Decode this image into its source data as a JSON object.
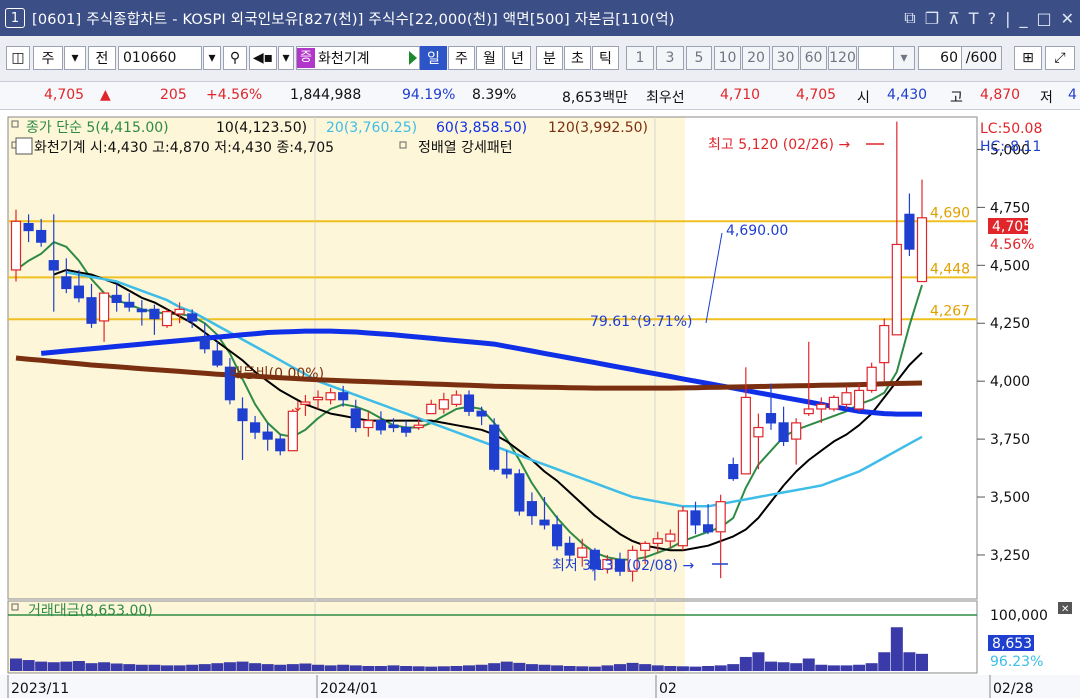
{
  "window": {
    "number": "1",
    "title": "[0601] 주식종합차트 - KOSPI 외국인보유[827(천)] 주식수[22,000(천)] 액면[500] 자본금[110(억)",
    "icons": [
      "restore-layout-icon",
      "duplicate-icon",
      "pin-icon",
      "font-icon",
      "help-icon",
      "minimize-icon",
      "maximize-icon",
      "close-icon"
    ]
  },
  "toolbar": {
    "market_label": "주",
    "prev_label": "전",
    "stock_code": "010660",
    "stock_tag": "증",
    "stock_name": "화천기계",
    "periods": [
      "일",
      "주",
      "월",
      "년",
      "분",
      "초",
      "틱"
    ],
    "selected_period": "일",
    "intervals": [
      "1",
      "3",
      "5",
      "10",
      "20",
      "30",
      "60",
      "120"
    ],
    "count_value": "60",
    "count_total": "/600"
  },
  "pricebar": {
    "price": "4,705",
    "change_arrow": "▲",
    "change": "205",
    "change_pct": "+4.56%",
    "volume": "1,844,988",
    "vol_ratio": "94.19%",
    "turnover": "8.39%",
    "amount": "8,653백만",
    "ask_label": "최우선",
    "ask1": "4,710",
    "ask2": "4,705",
    "open_label": "시",
    "open": "4,430",
    "high_label": "고",
    "high": "4,870",
    "low_label": "저",
    "low_trunc": "4"
  },
  "legend": {
    "close_ma_label": "종가 단순 5(4,415.00)",
    "ma10": "10(4,123.50)",
    "ma20": "20(3,760.25)",
    "ma60": "60(3,858.50)",
    "ma120": "120(3,992.50)",
    "ohlc": "화천기계 시:4,430 고:4,870 저:4,430 종:4,705",
    "pattern": "정배열 강세패턴",
    "lc": "LC:50.08",
    "hc": "HC:-8.11"
  },
  "annotations": {
    "high": "최고 5,120 (02/26) →",
    "low": "최저 3,135 (02/08) →",
    "level_4690": "4,690.00",
    "pct_line": "79.61°(9.71%)",
    "ratio_note": "배등비(0.00%)",
    "hline_labels": [
      "4,690",
      "4,448",
      "4,267"
    ],
    "last_price_tag": "4,705",
    "last_pct_tag": "4.56%"
  },
  "volume_panel": {
    "title": "거래대금(8,653.00)",
    "axis_label": "100,000",
    "value_tag": "8,653",
    "pct_tag": "96.23%"
  },
  "colors": {
    "titlebar": "#3b4e86",
    "up": "#e0262b",
    "down": "#1f3fd0",
    "ma5": "#2e8b45",
    "ma10": "#000000",
    "ma20": "#3dbde8",
    "ma60": "#1030e8",
    "ma120": "#7a3010",
    "hline": "#f0c020",
    "highlight_bg": "#fdf6d8"
  },
  "chart_data": {
    "type": "candlestick",
    "ylim": [
      3060,
      5140
    ],
    "y_ticks": [
      5000,
      4750,
      4500,
      4250,
      4000,
      3750,
      3500,
      3250
    ],
    "y_tick_labels": [
      "5,000",
      "4,750",
      "4,500",
      "4,250",
      "4,000",
      "3,750",
      "3,500",
      "3,250"
    ],
    "x_labels": [
      "2023/11",
      "2024/01",
      "02",
      "02/28"
    ],
    "horizontal_lines": [
      4690,
      4448,
      4267
    ],
    "candles": [
      [
        4480,
        4740,
        4430,
        4690
      ],
      [
        4680,
        4720,
        4600,
        4650
      ],
      [
        4650,
        4700,
        4580,
        4600
      ],
      [
        4520,
        4720,
        4300,
        4480
      ],
      [
        4450,
        4530,
        4380,
        4400
      ],
      [
        4410,
        4480,
        4340,
        4360
      ],
      [
        4360,
        4420,
        4230,
        4250
      ],
      [
        4260,
        4380,
        4170,
        4380
      ],
      [
        4370,
        4420,
        4300,
        4340
      ],
      [
        4340,
        4380,
        4300,
        4320
      ],
      [
        4310,
        4350,
        4240,
        4300
      ],
      [
        4310,
        4330,
        4200,
        4270
      ],
      [
        4240,
        4310,
        4230,
        4300
      ],
      [
        4290,
        4340,
        4250,
        4310
      ],
      [
        4290,
        4310,
        4230,
        4260
      ],
      [
        4190,
        4250,
        4120,
        4140
      ],
      [
        4130,
        4170,
        4060,
        4070
      ],
      [
        4060,
        4100,
        3900,
        3920
      ],
      [
        3880,
        3930,
        3660,
        3830
      ],
      [
        3820,
        3850,
        3750,
        3780
      ],
      [
        3780,
        3820,
        3700,
        3750
      ],
      [
        3750,
        3770,
        3680,
        3700
      ],
      [
        3700,
        3880,
        3700,
        3870
      ],
      [
        3900,
        3940,
        3850,
        3910
      ],
      [
        3920,
        3960,
        3880,
        3930
      ],
      [
        3920,
        3970,
        3900,
        3950
      ],
      [
        3950,
        3980,
        3890,
        3920
      ],
      [
        3880,
        3920,
        3780,
        3800
      ],
      [
        3800,
        3870,
        3760,
        3830
      ],
      [
        3830,
        3870,
        3770,
        3790
      ],
      [
        3810,
        3840,
        3780,
        3800
      ],
      [
        3800,
        3830,
        3760,
        3780
      ],
      [
        3800,
        3840,
        3790,
        3810
      ],
      [
        3860,
        3920,
        3860,
        3900
      ],
      [
        3880,
        3950,
        3860,
        3920
      ],
      [
        3900,
        3960,
        3890,
        3940
      ],
      [
        3940,
        3960,
        3850,
        3870
      ],
      [
        3870,
        3890,
        3810,
        3850
      ],
      [
        3810,
        3840,
        3610,
        3620
      ],
      [
        3620,
        3700,
        3580,
        3600
      ],
      [
        3600,
        3620,
        3420,
        3440
      ],
      [
        3480,
        3520,
        3380,
        3420
      ],
      [
        3400,
        3500,
        3360,
        3380
      ],
      [
        3380,
        3420,
        3270,
        3290
      ],
      [
        3300,
        3330,
        3220,
        3250
      ],
      [
        3240,
        3320,
        3200,
        3280
      ],
      [
        3270,
        3280,
        3140,
        3190
      ],
      [
        3190,
        3250,
        3170,
        3230
      ],
      [
        3230,
        3260,
        3160,
        3180
      ],
      [
        3180,
        3290,
        3135,
        3270
      ],
      [
        3270,
        3310,
        3210,
        3300
      ],
      [
        3300,
        3350,
        3260,
        3320
      ],
      [
        3310,
        3360,
        3280,
        3340
      ],
      [
        3290,
        3460,
        3270,
        3440
      ],
      [
        3440,
        3480,
        3340,
        3380
      ],
      [
        3380,
        3470,
        3340,
        3350
      ],
      [
        3350,
        3510,
        3150,
        3480
      ],
      [
        3640,
        3670,
        3570,
        3580
      ],
      [
        3600,
        4060,
        3600,
        3930
      ],
      [
        3760,
        3860,
        3620,
        3800
      ],
      [
        3860,
        3990,
        3790,
        3820
      ],
      [
        3820,
        3890,
        3720,
        3740
      ],
      [
        3750,
        3840,
        3640,
        3820
      ],
      [
        3860,
        4170,
        3850,
        3880
      ],
      [
        3880,
        3930,
        3820,
        3900
      ],
      [
        3880,
        3940,
        3870,
        3930
      ],
      [
        3900,
        3980,
        3880,
        3950
      ],
      [
        3880,
        3990,
        3870,
        3960
      ],
      [
        3960,
        4080,
        3950,
        4060
      ],
      [
        4080,
        4270,
        4000,
        4240
      ],
      [
        4200,
        5120,
        4200,
        4590
      ],
      [
        4720,
        4810,
        4540,
        4570
      ],
      [
        4430,
        4870,
        4430,
        4705
      ]
    ],
    "series": [
      {
        "name": "5",
        "values": [
          4480,
          4520,
          4550,
          4600,
          4580,
          4520,
          4440,
          4380,
          4350,
          4330,
          4310,
          4300,
          4290,
          4290,
          4280,
          4250,
          4200,
          4120,
          4010,
          3900,
          3820,
          3770,
          3760,
          3790,
          3840,
          3880,
          3900,
          3890,
          3870,
          3840,
          3810,
          3800,
          3800,
          3820,
          3850,
          3880,
          3890,
          3880,
          3820,
          3750,
          3660,
          3560,
          3480,
          3410,
          3350,
          3300,
          3260,
          3240,
          3230,
          3230,
          3240,
          3260,
          3280,
          3310,
          3330,
          3350,
          3370,
          3410,
          3540,
          3640,
          3700,
          3760,
          3790,
          3810,
          3830,
          3850,
          3870,
          3900,
          3920,
          3950,
          4040,
          4240,
          4415
        ]
      },
      {
        "name": "10",
        "values": [
          4460,
          4480,
          4470,
          4460,
          4440,
          4420,
          4390,
          4360,
          4340,
          4310,
          4280,
          4250,
          4210,
          4170,
          4130,
          4090,
          4040,
          4000,
          3960,
          3930,
          3900,
          3880,
          3860,
          3850,
          3840,
          3830,
          3830,
          3830,
          3830,
          3830,
          3830,
          3820,
          3810,
          3800,
          3790,
          3770,
          3740,
          3700,
          3660,
          3610,
          3570,
          3520,
          3470,
          3420,
          3380,
          3340,
          3310,
          3290,
          3280,
          3270,
          3270,
          3280,
          3290,
          3310,
          3330,
          3360,
          3410,
          3480,
          3550,
          3610,
          3660,
          3700,
          3740,
          3770,
          3810,
          3860,
          3930,
          4000,
          4070,
          4123
        ]
      },
      {
        "name": "20",
        "values": [
          4470,
          4460,
          4450,
          4440,
          4430,
          4410,
          4390,
          4370,
          4350,
          4320,
          4300,
          4270,
          4240,
          4210,
          4180,
          4150,
          4120,
          4090,
          4060,
          4030,
          4000,
          3980,
          3960,
          3940,
          3920,
          3900,
          3880,
          3860,
          3840,
          3820,
          3800,
          3780,
          3760,
          3740,
          3720,
          3700,
          3680,
          3660,
          3640,
          3620,
          3600,
          3580,
          3560,
          3540,
          3520,
          3500,
          3490,
          3480,
          3470,
          3460,
          3460,
          3460,
          3470,
          3480,
          3490,
          3500,
          3510,
          3520,
          3530,
          3540,
          3550,
          3570,
          3590,
          3610,
          3640,
          3670,
          3700,
          3730,
          3760
        ]
      },
      {
        "name": "60",
        "values": [
          4120,
          4125,
          4130,
          4135,
          4140,
          4145,
          4150,
          4155,
          4160,
          4165,
          4170,
          4175,
          4180,
          4185,
          4190,
          4195,
          4200,
          4205,
          4210,
          4212,
          4214,
          4216,
          4216,
          4216,
          4214,
          4212,
          4208,
          4204,
          4200,
          4195,
          4190,
          4185,
          4180,
          4175,
          4170,
          4165,
          4160,
          4150,
          4140,
          4130,
          4120,
          4110,
          4100,
          4090,
          4080,
          4070,
          4060,
          4050,
          4040,
          4030,
          4020,
          4010,
          4000,
          3990,
          3980,
          3970,
          3960,
          3950,
          3940,
          3930,
          3920,
          3910,
          3900,
          3890,
          3880,
          3870,
          3865,
          3860,
          3858,
          3858,
          3858
        ]
      },
      {
        "name": "120",
        "values": [
          4100,
          4095,
          4090,
          4085,
          4080,
          4075,
          4070,
          4066,
          4062,
          4058,
          4054,
          4050,
          4046,
          4042,
          4038,
          4034,
          4030,
          4027,
          4024,
          4021,
          4018,
          4015,
          4012,
          4009,
          4006,
          4004,
          4002,
          4000,
          3998,
          3996,
          3994,
          3992,
          3990,
          3988,
          3986,
          3984,
          3982,
          3980,
          3978,
          3977,
          3976,
          3975,
          3974,
          3973,
          3972,
          3971,
          3970,
          3970,
          3970,
          3970,
          3970,
          3970,
          3970,
          3971,
          3972,
          3973,
          3974,
          3975,
          3976,
          3977,
          3978,
          3979,
          3980,
          3981,
          3982,
          3983,
          3984,
          3985,
          3987,
          3989,
          3990,
          3991,
          3992
        ]
      }
    ],
    "volume_amounts": [
      40,
      35,
      30,
      28,
      30,
      32,
      25,
      28,
      24,
      22,
      20,
      20,
      18,
      18,
      20,
      22,
      25,
      28,
      30,
      25,
      22,
      20,
      22,
      24,
      20,
      18,
      20,
      18,
      16,
      16,
      18,
      16,
      15,
      14,
      15,
      16,
      18,
      20,
      25,
      30,
      26,
      22,
      20,
      18,
      16,
      15,
      14,
      18,
      22,
      26,
      22,
      18,
      16,
      15,
      14,
      16,
      18,
      22,
      45,
      60,
      30,
      28,
      25,
      40,
      20,
      18,
      18,
      20,
      25,
      60,
      140,
      60,
      55
    ]
  }
}
